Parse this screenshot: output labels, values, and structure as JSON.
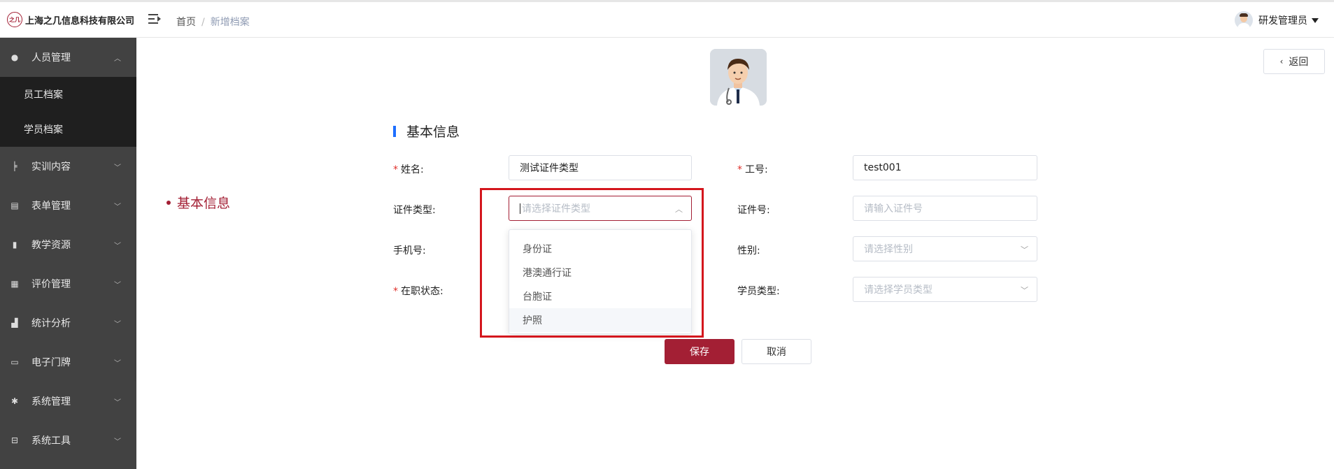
{
  "header": {
    "company": "上海之几信息科技有限公司",
    "logo_text": "之几",
    "breadcrumb": [
      "首页",
      "新增档案"
    ],
    "breadcrumb_separator": "/",
    "user_name": "研发管理员"
  },
  "sidebar": {
    "items": [
      {
        "label": "人员管理",
        "icon": "people-icon",
        "expanded": true
      },
      {
        "label": "实训内容",
        "icon": "tree-icon"
      },
      {
        "label": "表单管理",
        "icon": "form-icon"
      },
      {
        "label": "教学资源",
        "icon": "book-icon"
      },
      {
        "label": "评价管理",
        "icon": "evaluate-icon"
      },
      {
        "label": "统计分析",
        "icon": "bar-chart-icon"
      },
      {
        "label": "电子门牌",
        "icon": "monitor-icon"
      },
      {
        "label": "系统管理",
        "icon": "gear-icon"
      },
      {
        "label": "系统工具",
        "icon": "toolbox-icon"
      }
    ],
    "subitems": [
      "员工档案",
      "学员档案"
    ]
  },
  "page": {
    "back_label": "返回",
    "anchor_label": "基本信息",
    "section_title": "基本信息",
    "save_label": "保存",
    "cancel_label": "取消"
  },
  "form": {
    "name": {
      "label": "姓名:",
      "required": true,
      "value": "测试证件类型"
    },
    "job_no": {
      "label": "工号:",
      "required": true,
      "value": "test001"
    },
    "id_type": {
      "label": "证件类型:",
      "placeholder": "请选择证件类型"
    },
    "id_no": {
      "label": "证件号:",
      "placeholder": "请输入证件号"
    },
    "phone": {
      "label": "手机号:"
    },
    "gender": {
      "label": "性别:",
      "placeholder": "请选择性别"
    },
    "status": {
      "label": "在职状态:",
      "required": true
    },
    "student_type": {
      "label": "学员类型:",
      "placeholder": "请选择学员类型"
    }
  },
  "dropdown": {
    "options": [
      "身份证",
      "港澳通行证",
      "台胞证",
      "护照"
    ],
    "hovered_option": "护照"
  },
  "colors": {
    "brand": "#a31f34",
    "sidebar_bg": "#424242",
    "submenu_bg": "#1f1f1f",
    "section_bar": "#1e6fff",
    "annotation_border": "#d4161d"
  }
}
